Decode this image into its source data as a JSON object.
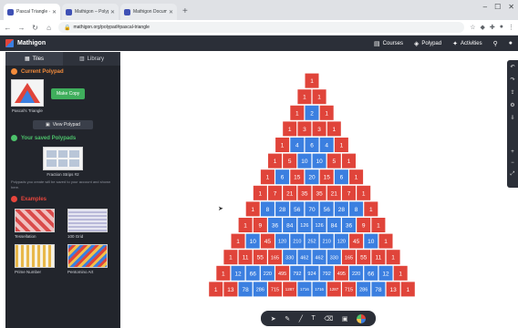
{
  "browser": {
    "tabs": [
      {
        "label": "Pascal Triangle · Polypad",
        "active": true
      },
      {
        "label": "Mathigon – Polypad Tools",
        "active": false
      },
      {
        "label": "Mathigon Documentation",
        "active": false
      }
    ],
    "new_tab": "+",
    "url": "mathigon.org/polypad#pascal-triangle"
  },
  "app": {
    "brand": "Mathigon",
    "nav": [
      {
        "label": "Courses",
        "icon": "book-icon"
      },
      {
        "label": "Polypad",
        "icon": "shapes-icon"
      },
      {
        "label": "Activities",
        "icon": "puzzle-icon"
      }
    ]
  },
  "sidebar": {
    "tabs": [
      {
        "label": "Tiles",
        "icon": "tiles-icon",
        "active": true
      },
      {
        "label": "Library",
        "icon": "library-icon",
        "active": false
      }
    ],
    "current": {
      "heading": "Current Polypad",
      "thumb_caption": "Pascal's Triangle",
      "copy_button": "Make Copy",
      "view_button": "View Polypad"
    },
    "saved": {
      "heading": "Your saved Polypads",
      "thumb_caption": "Fraction Strips #2",
      "note": "Polypads you create will be saved to your account and shown here."
    },
    "examples": {
      "heading": "Examples",
      "items": [
        {
          "caption": "Tessellation"
        },
        {
          "caption": "100 Grid"
        },
        {
          "caption": "Prime Number"
        },
        {
          "caption": "Pentomino Art"
        }
      ]
    }
  },
  "chart_data": {
    "type": "table",
    "rows": [
      [
        1
      ],
      [
        1,
        1
      ],
      [
        1,
        2,
        1
      ],
      [
        1,
        3,
        3,
        1
      ],
      [
        1,
        4,
        6,
        4,
        1
      ],
      [
        1,
        5,
        10,
        10,
        5,
        1
      ],
      [
        1,
        6,
        15,
        20,
        15,
        6,
        1
      ],
      [
        1,
        7,
        21,
        35,
        35,
        21,
        7,
        1
      ],
      [
        1,
        8,
        28,
        56,
        70,
        56,
        28,
        8,
        1
      ],
      [
        1,
        9,
        36,
        84,
        126,
        126,
        84,
        36,
        9,
        1
      ],
      [
        1,
        10,
        45,
        120,
        210,
        252,
        210,
        120,
        45,
        10,
        1
      ],
      [
        1,
        11,
        55,
        165,
        330,
        462,
        462,
        330,
        165,
        55,
        11,
        1
      ],
      [
        1,
        12,
        66,
        220,
        495,
        792,
        924,
        792,
        495,
        220,
        66,
        12,
        1
      ],
      [
        1,
        13,
        78,
        286,
        715,
        1287,
        1716,
        1716,
        1287,
        715,
        286,
        78,
        13,
        1
      ]
    ],
    "colors": {
      "odd": "#e0443a",
      "even": "#3b7fe0",
      "text": "#ffffff"
    }
  }
}
